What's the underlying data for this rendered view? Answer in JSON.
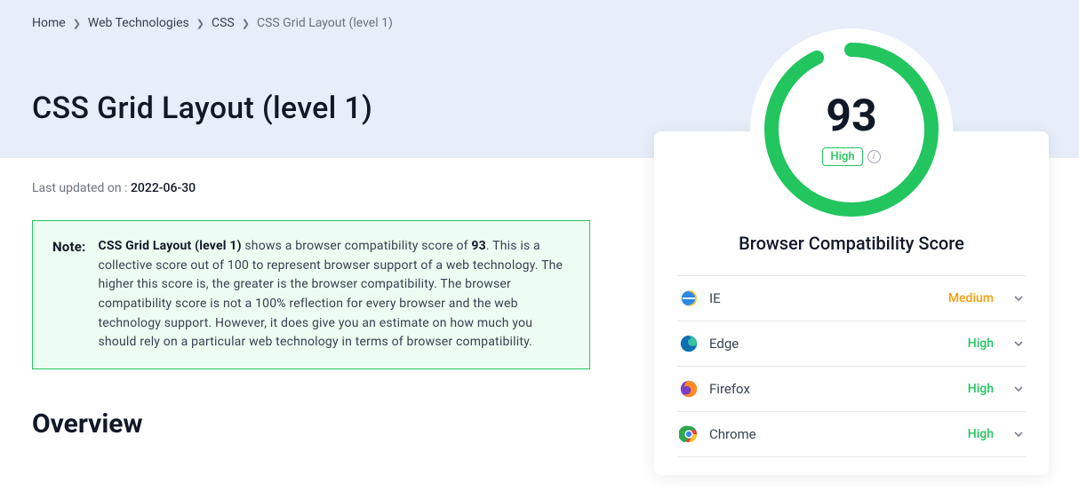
{
  "breadcrumb": {
    "items": [
      "Home",
      "Web Technologies",
      "CSS"
    ],
    "current": "CSS Grid Layout (level 1)"
  },
  "page_title": "CSS Grid Layout (level 1)",
  "last_updated": {
    "label": "Last updated on : ",
    "date": "2022-06-30"
  },
  "note": {
    "label": "Note:",
    "text_parts": {
      "pre": "",
      "tech": "CSS Grid Layout (level 1)",
      "mid1": " shows a browser compatibility score of ",
      "score": "93",
      "tail": ". This is a collective score out of 100 to represent browser support of a web technology. The higher this score is, the greater is the browser compatibility. The browser compatibility score is not a 100% reflection for every browser and the web technology support. However, it does give you an estimate on how much you should rely on a particular web technology in terms of browser compatibility."
    }
  },
  "overview_heading": "Overview",
  "card": {
    "score": "93",
    "score_level": "High",
    "title": "Browser Compatibility Score",
    "browsers": [
      {
        "name": "IE",
        "level": "Medium",
        "color": "medium"
      },
      {
        "name": "Edge",
        "level": "High",
        "color": "high"
      },
      {
        "name": "Firefox",
        "level": "High",
        "color": "high"
      },
      {
        "name": "Chrome",
        "level": "High",
        "color": "high"
      }
    ]
  },
  "colors": {
    "high": "#22c55e",
    "medium": "#f59e0b"
  }
}
